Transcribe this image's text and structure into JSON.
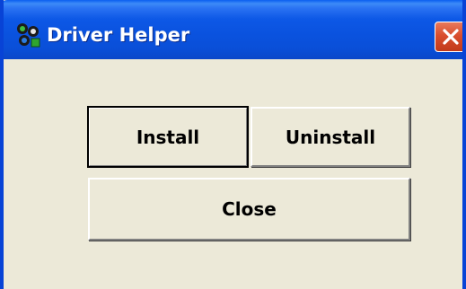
{
  "window": {
    "title": "Driver Helper",
    "icon": "driver-helper-app-icon",
    "close_icon": "close-icon",
    "titlebar_color": "#0a52de",
    "close_color": "#d94e2e",
    "face_color": "#ece9d8"
  },
  "buttons": {
    "install_label": "Install",
    "uninstall_label": "Uninstall",
    "close_label": "Close"
  }
}
